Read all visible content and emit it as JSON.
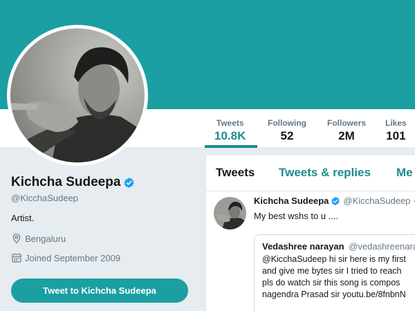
{
  "colors": {
    "banner": "#1b9fa2",
    "accent": "#1b8c8e",
    "button": "#1b9fa2",
    "verified": "#1da1f2",
    "page_bg": "#e6ecf0"
  },
  "stats": [
    {
      "label": "Tweets",
      "value": "10.8K",
      "active": true
    },
    {
      "label": "Following",
      "value": "52"
    },
    {
      "label": "Followers",
      "value": "2M"
    },
    {
      "label": "Likes",
      "value": "101"
    }
  ],
  "profile": {
    "name": "Kichcha Sudeepa",
    "verified_icon": "verified-badge-icon",
    "handle": "@KicchaSudeep",
    "bio": "Artist.",
    "location": "Bengaluru",
    "location_icon": "location-pin-icon",
    "joined": "Joined September 2009",
    "joined_icon": "calendar-icon",
    "tweet_to_label": "Tweet to Kichcha Sudeepa"
  },
  "timeline": {
    "tabs": [
      "Tweets",
      "Tweets & replies",
      "Me"
    ],
    "active_tab": 0,
    "tweet": {
      "name": "Kichcha Sudeepa",
      "handle": "@KicchaSudeep ·",
      "text": "My best wshs to u ....",
      "quote": {
        "name": "Vedashree narayan",
        "handle": "@vedashreenara",
        "lines": [
          "@KicchaSudeep hi sir here is my first",
          "and give me bytes sir I tried to reach",
          "pls do watch sir  this song is compos",
          "nagendra Prasad sir youtu.be/8fnbnN"
        ]
      }
    }
  }
}
